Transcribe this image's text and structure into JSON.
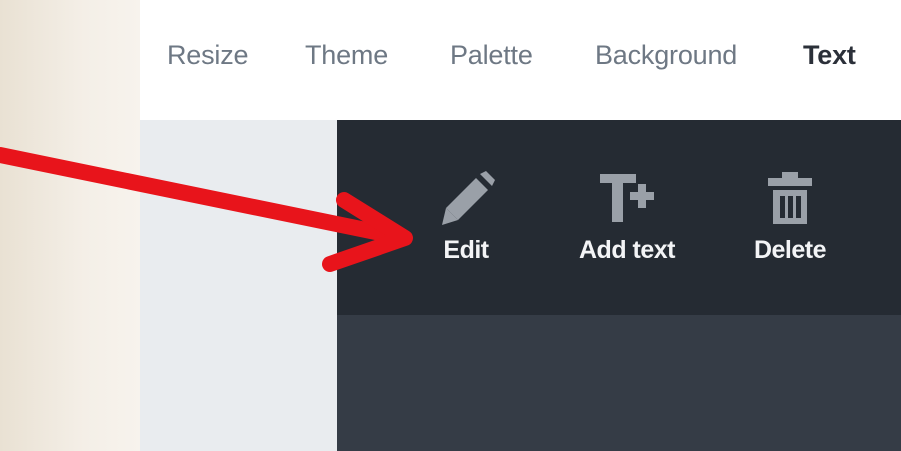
{
  "tabs": [
    {
      "label": "Resize",
      "active": false
    },
    {
      "label": "Theme",
      "active": false
    },
    {
      "label": "Palette",
      "active": false
    },
    {
      "label": "Background",
      "active": false
    },
    {
      "label": "Text",
      "active": true
    }
  ],
  "toolbar": {
    "tools": [
      {
        "label": "Edit",
        "icon": "pencil-icon"
      },
      {
        "label": "Add text",
        "icon": "add-text-icon"
      },
      {
        "label": "Delete",
        "icon": "trash-icon"
      }
    ]
  },
  "colors": {
    "toolbar_bg": "#252b33",
    "lower_panel_bg": "#353c46",
    "left_panel_bg": "#e9ecef",
    "tab_inactive": "#6e7884",
    "tab_active": "#2b3039",
    "icon_gray": "#9aa0a8",
    "annotation_arrow": "#e8141b"
  }
}
